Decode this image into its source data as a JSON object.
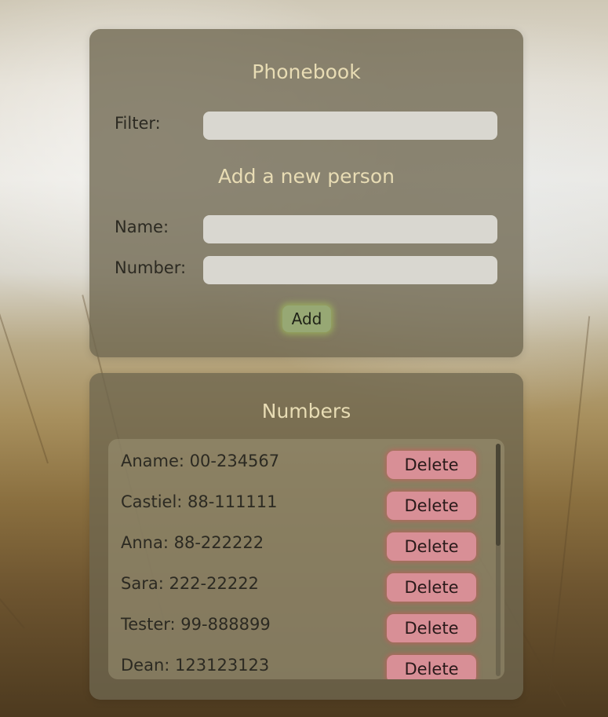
{
  "phonebook": {
    "title": "Phonebook",
    "filter_label": "Filter:",
    "filter_value": "",
    "add_title": "Add a new person",
    "name_label": "Name:",
    "name_value": "",
    "number_label": "Number:",
    "number_value": "",
    "add_button": "Add"
  },
  "numbers": {
    "title": "Numbers",
    "delete_label": "Delete",
    "entries": [
      "Aname: 00-234567",
      "Castiel: 88-111111",
      "Anna: 88-222222",
      "Sara: 222-22222",
      "Tester: 99-888899",
      "Dean: 123123123"
    ]
  },
  "colors": {
    "panel": "#6e6650",
    "heading": "#e8dcb4",
    "add_button": "#97a874",
    "delete_button": "#d88f96",
    "input": "#d9d7d0"
  }
}
